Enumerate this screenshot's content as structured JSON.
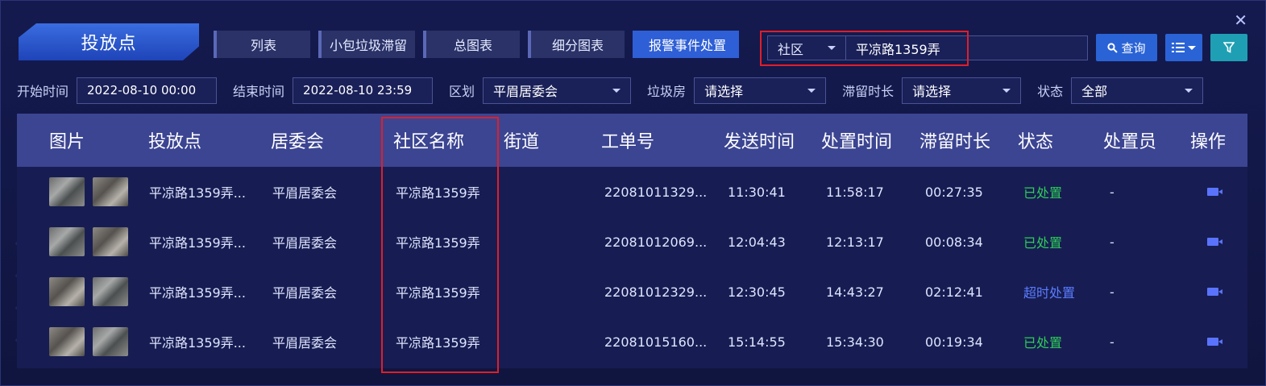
{
  "header": {
    "title": "投放点",
    "close": "✕",
    "tabs": [
      {
        "label": "列表",
        "active": false
      },
      {
        "label": "小包垃圾滞留",
        "active": false
      },
      {
        "label": "总图表",
        "active": false
      },
      {
        "label": "细分图表",
        "active": false
      },
      {
        "label": "报警事件处置",
        "active": true
      }
    ],
    "search": {
      "type_value": "社区",
      "input_value": "平凉路1359弄",
      "query_label": "查询"
    },
    "icons": {
      "query": "search-icon",
      "list": "list-icon",
      "filter": "filter-icon"
    }
  },
  "filters": {
    "start_label": "开始时间",
    "start_value": "2022-08-10 00:00",
    "end_label": "结束时间",
    "end_value": "2022-08-10 23:59",
    "district_label": "区划",
    "district_value": "平眉居委会",
    "garbage_label": "垃圾房",
    "garbage_value": "请选择",
    "stay_label": "滞留时长",
    "stay_value": "请选择",
    "status_label": "状态",
    "status_value": "全部"
  },
  "table": {
    "columns": [
      "图片",
      "投放点",
      "居委会",
      "社区名称",
      "街道",
      "工单号",
      "发送时间",
      "处置时间",
      "滞留时长",
      "状态",
      "处置员",
      "操作"
    ],
    "rows": [
      {
        "point": "平凉路1359弄...",
        "committee": "平眉居委会",
        "community": "平凉路1359弄",
        "street": "",
        "order": "22081011329...",
        "send": "11:30:41",
        "handle": "11:58:17",
        "stay": "00:27:35",
        "status": "已处置",
        "status_type": "done",
        "staff": "-"
      },
      {
        "point": "平凉路1359弄...",
        "committee": "平眉居委会",
        "community": "平凉路1359弄",
        "street": "",
        "order": "22081012069...",
        "send": "12:04:43",
        "handle": "12:13:17",
        "stay": "00:08:34",
        "status": "已处置",
        "status_type": "done",
        "staff": "-"
      },
      {
        "point": "平凉路1359弄...",
        "committee": "平眉居委会",
        "community": "平凉路1359弄",
        "street": "",
        "order": "22081012329...",
        "send": "12:30:45",
        "handle": "14:43:27",
        "stay": "02:12:41",
        "status": "超时处置",
        "status_type": "late",
        "staff": "-"
      },
      {
        "point": "平凉路1359弄...",
        "committee": "平眉居委会",
        "community": "平凉路1359弄",
        "street": "",
        "order": "22081015160...",
        "send": "15:14:55",
        "handle": "15:34:30",
        "stay": "00:19:34",
        "status": "已处置",
        "status_type": "done",
        "staff": "-"
      }
    ]
  },
  "colors": {
    "accent": "#2a63d6",
    "done": "#2ecc5a",
    "late": "#5b7cff",
    "highlight": "#e01e2a"
  }
}
